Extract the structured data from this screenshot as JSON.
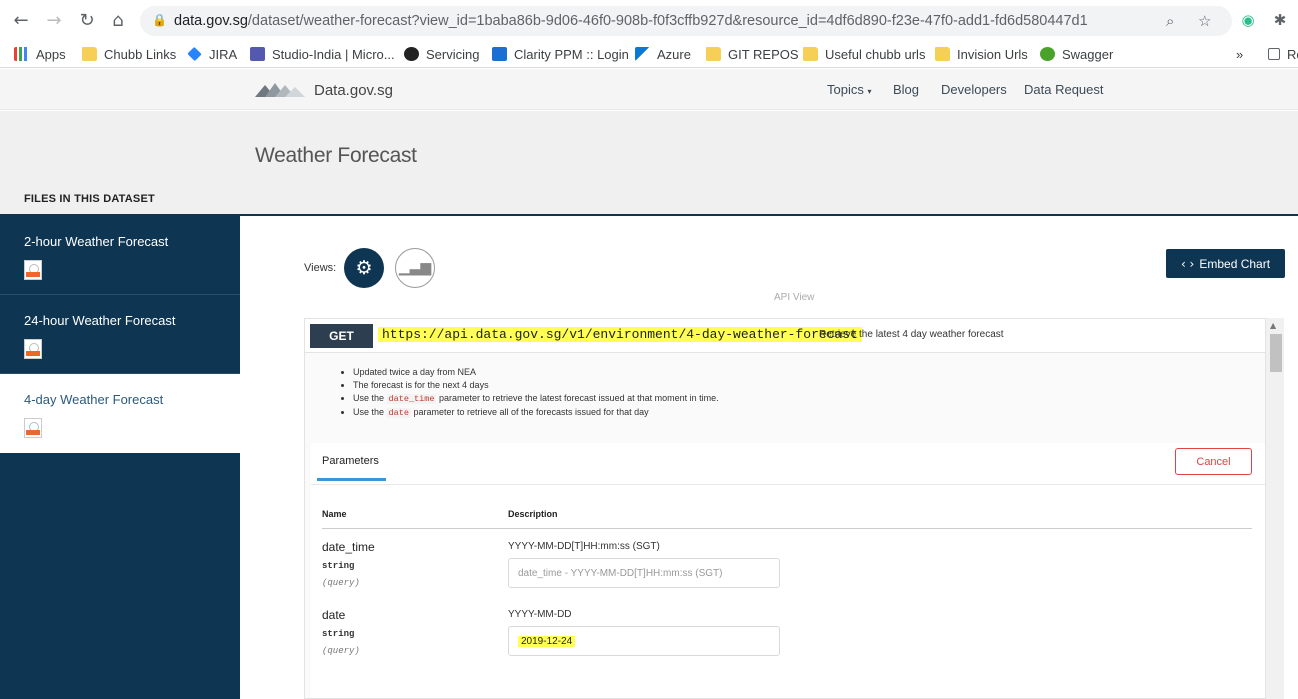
{
  "browser": {
    "url_host": "data.gov.sg",
    "url_rest": "/dataset/weather-forecast?view_id=1baba86b-9d06-46f0-908b-f0f3cffb927d&resource_id=4df6d890-f23e-47f0-add1-fd6d580447d1",
    "bookmarks": [
      "Apps",
      "Chubb Links",
      "JIRA",
      "Studio-India | Micro...",
      "Servicing",
      "Clarity PPM :: Login",
      "Azure",
      "GIT REPOS",
      "Useful chubb urls",
      "Invision Urls",
      "Swagger"
    ],
    "more": "»",
    "overflow_item": "Re"
  },
  "site": {
    "name": "Data.gov.sg",
    "nav": [
      "Topics",
      "Blog",
      "Developers",
      "Data Request"
    ]
  },
  "page": {
    "title": "Weather Forecast",
    "files_heading": "FILES IN THIS DATASET"
  },
  "sidebar": {
    "items": [
      {
        "label": "2-hour Weather Forecast",
        "badge": "API"
      },
      {
        "label": "24-hour Weather Forecast",
        "badge": "API"
      },
      {
        "label": "4-day Weather Forecast",
        "badge": "API"
      }
    ]
  },
  "views": {
    "label": "Views:",
    "embed_label": "Embed Chart",
    "api_view_label": "API View"
  },
  "api": {
    "method": "GET",
    "endpoint": "https://api.data.gov.sg/v1/environment/4-day-weather-forecast",
    "summary": "Retrieve the latest 4 day weather forecast",
    "notes": {
      "n1": "Updated twice a day from NEA",
      "n2": "The forecast is for the next 4 days",
      "n3_pre": "Use the",
      "n3_code": "date_time",
      "n3_post": "parameter to retrieve the latest forecast issued at that moment in time.",
      "n4_pre": "Use the",
      "n4_code": "date",
      "n4_post": "parameter to retrieve all of the forecasts issued for that day"
    },
    "tab_label": "Parameters",
    "cancel_label": "Cancel",
    "col_name": "Name",
    "col_description": "Description",
    "params": [
      {
        "name": "date_time",
        "type": "string",
        "in": "(query)",
        "description": "YYYY-MM-DD[T]HH:mm:ss (SGT)",
        "placeholder": "date_time - YYYY-MM-DD[T]HH:mm:ss (SGT)",
        "value": ""
      },
      {
        "name": "date",
        "type": "string",
        "in": "(query)",
        "description": "YYYY-MM-DD",
        "placeholder": "",
        "value": "2019-12-24"
      }
    ]
  }
}
